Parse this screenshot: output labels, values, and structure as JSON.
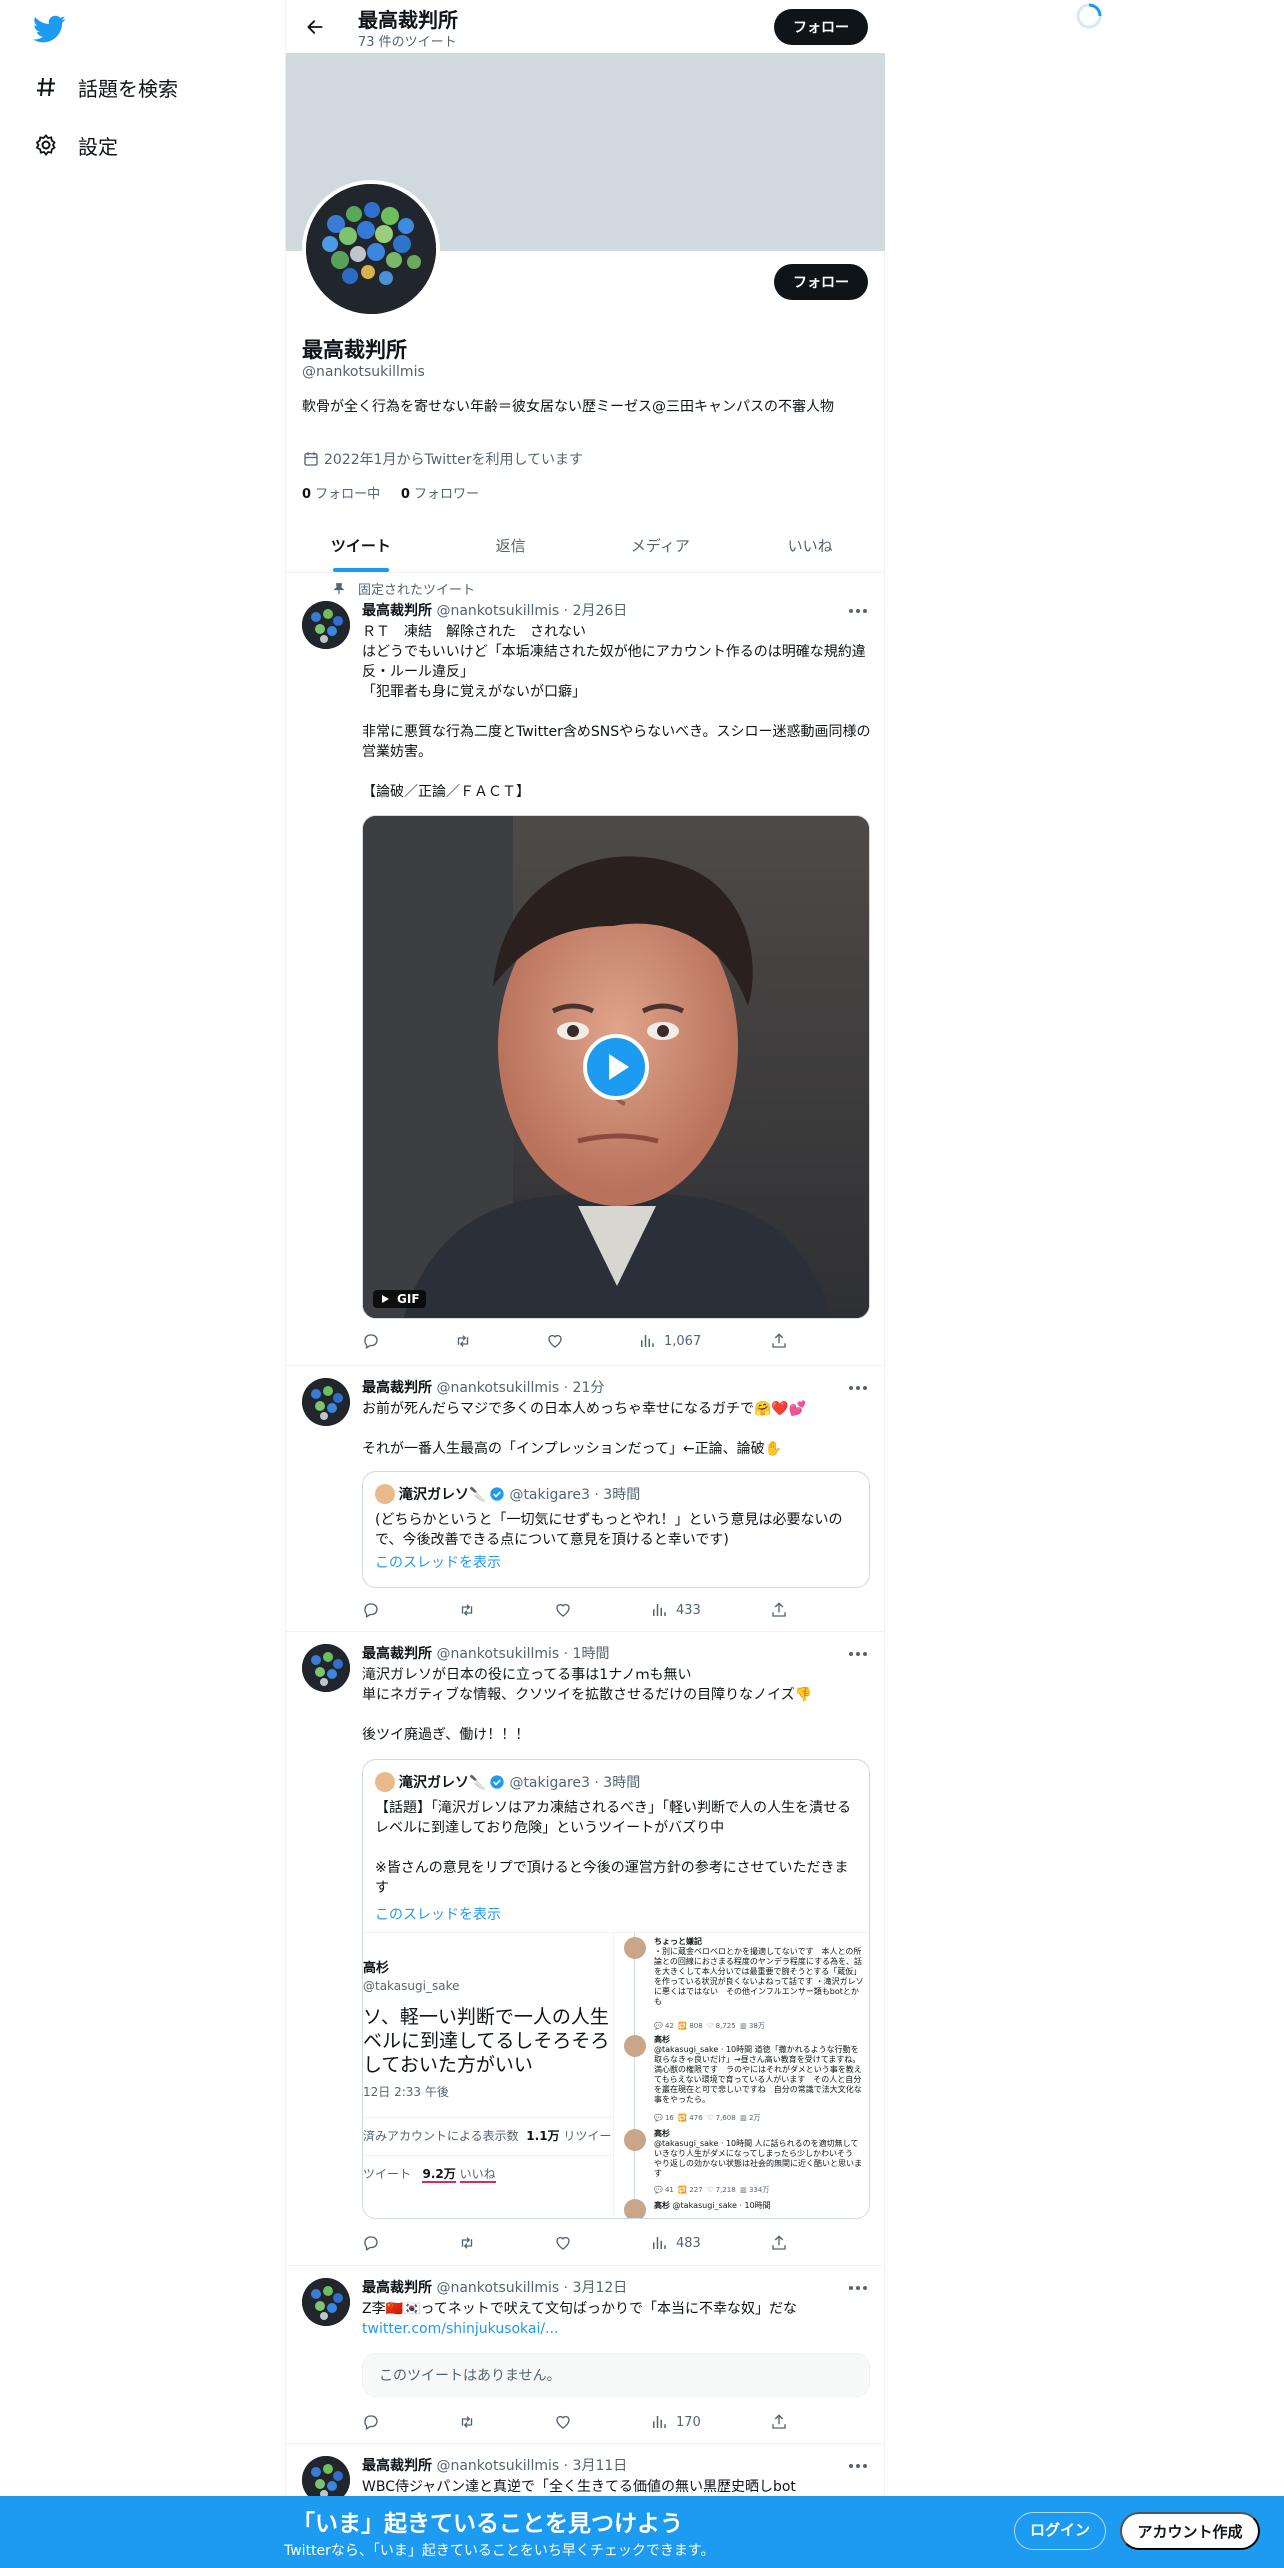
{
  "nav": {
    "logo": "twitter-bird-icon",
    "items": [
      {
        "label": "話題を検索",
        "icon": "hashtag-icon"
      },
      {
        "label": "設定",
        "icon": "gear-icon"
      }
    ]
  },
  "header": {
    "name": "最高裁判所",
    "tweet_count": "73 件のツイート",
    "follow_label": "フォロー"
  },
  "profile": {
    "follow_label": "フォロー",
    "name": "最高裁判所",
    "handle": "@nankotsukillmis",
    "bio": "軟骨が全く行為を寄せない年齢＝彼女居ない歴ミーゼス@三田キャンパスの不審人物",
    "joined": "2022年1月からTwitterを利用しています",
    "following_count": "0",
    "following_label": " フォロー中",
    "followers_count": "0",
    "followers_label": " フォロワー"
  },
  "tabs": [
    "ツイート",
    "返信",
    "メディア",
    "いいね"
  ],
  "tweets": [
    {
      "pinned_label": "固定されたツイート",
      "name": "最高裁判所",
      "handle_time": " @nankotsukillmis · 2月26日",
      "body": "ＲＴ　凍結　解除された　されない\nはどうでもいいけど「本垢凍結された奴が他にアカウント作るのは明確な規約違反・ルール違反」\n「犯罪者も身に覚えがないが口癖」\n\n非常に悪質な行為二度とTwitter含めSNSやらないべき。スシロー迷惑動画同様の営業妨害。\n\n【論破／正論／ＦＡＣＴ】",
      "gif_label": "GIF",
      "views": "1,067"
    },
    {
      "name": "最高裁判所",
      "handle_time": " @nankotsukillmis · 21分",
      "body": "お前が死んだらマジで多くの日本人めっちゃ幸せになるガチで🤗❤️💕\n\nそれが一番人生最高の「インプレッションだって」←正論、論破✋",
      "quote": {
        "name": "滝沢ガレソ🔪",
        "handle_time": "@takigare3 · 3時間",
        "body": "(どちらかというと「一切気にせずもっとやれ！」という意見は必要ないので、今後改善できる点について意見を頂けると幸いです)",
        "thread_label": "このスレッドを表示"
      },
      "views": "433"
    },
    {
      "name": "最高裁判所",
      "handle_time": " @nankotsukillmis · 1時間",
      "body": "滝沢ガレソが日本の役に立ってる事は1ナノｍも無い\n単にネガティブな情報、クソツイを拡散させるだけの目障りなノイズ👎\n\n後ツイ廃過ぎ、働け！！！",
      "quote": {
        "name": "滝沢ガレソ🔪",
        "handle_time": "@takigare3 · 3時間",
        "body": "【話題】「滝沢ガレソはアカ凍結されるべき」「軽い判断で人の人生を潰せるレベルに到達しており危険」というツイートがバズり中\n\n※皆さんの意見をリプで頂けると今後の運営方針の参考にさせていただきます",
        "thread_label": "このスレッドを表示",
        "screenshot": {
          "left_name": "高杉",
          "left_handle": "@takasugi_sake",
          "left_text": "ソ、軽一い判断で一人の人生\nベルに到達してるしそろそろ\nしておいた方がいい",
          "left_time": "12日 2:33 午後",
          "left_views": "済みアカウントによる表示数",
          "left_views_num": "1.1万",
          "left_rt_label": "リツイー",
          "left_likes_prefix": "ツイート",
          "left_likes_num": "9.2万",
          "left_likes_label": "いいね",
          "replies": [
            {
              "name": "ちょっと嫌記",
              "text": "・別に蔵金ベロベロとかを撮適してないです　本人との所論との回線におさまる程度のヤンデラ程度にする為を、話を大きくして本人分いでは最重要で腕そうとする「蔵仮」を作っている状況が良くないよねって話です\n・滝沢ガレソに悪くはではない　その他インフルエンサー類もbotとかも"
            },
            {
              "name": "高杉",
              "text": "@takasugi_sake · 10時間\n道徳「撒かれるような行動を取らなきゃ良いだけ」→昼さん高い教育を受けてますね。満心獣の権限です　ラのやにはそれがダメという事を教えてもらえない環境で育っている人がいます　その人と自分を叢在現在と可で悲しいですね　自分の常識で法大文化な事をやったら。"
            },
            {
              "name": "高杉",
              "text": "@takasugi_sake · 10時間\n人に話られるのを適切無していきなり人生がダメになってしまったら少しかわいそう　やり返しの効かない状態は社会的無関に近く酷いと思います"
            },
            {
              "name": "高杉",
              "text": "@takasugi_sake · 10時間"
            }
          ],
          "reply_counts": [
            "42",
            "808",
            "8,725",
            "38万",
            "16",
            "476",
            "7,608",
            "2万",
            "41",
            "227",
            "7,218",
            "334万"
          ]
        }
      },
      "views": "483"
    },
    {
      "name": "最高裁判所",
      "handle_time": " @nankotsukillmis · 3月12日",
      "body": "Z李🇨🇳🇰🇷ってネットで吠えて文句ばっかりで「本当に不幸な奴」だな",
      "link": "twitter.com/shinjukusokai/...",
      "unavailable": "このツイートはありません。",
      "views": "170"
    },
    {
      "name": "最高裁判所",
      "handle_time": " @nankotsukillmis · 3月11日",
      "body": "WBC侍ジャパン達と真逆で「全く生きてる価値の無い黒歴史晒しbot"
    }
  ],
  "bottom_bar": {
    "title": "「いま」起きていることを見つけよう",
    "subtitle": "Twitterなら、「いま」起きていることをいち早くチェックできます。",
    "login_label": "ログイン",
    "signup_label": "アカウント作成"
  },
  "colors": {
    "accent": "#1d9bf0",
    "text": "#0f1419",
    "secondary": "#536471",
    "banner": "#cfd9de"
  }
}
